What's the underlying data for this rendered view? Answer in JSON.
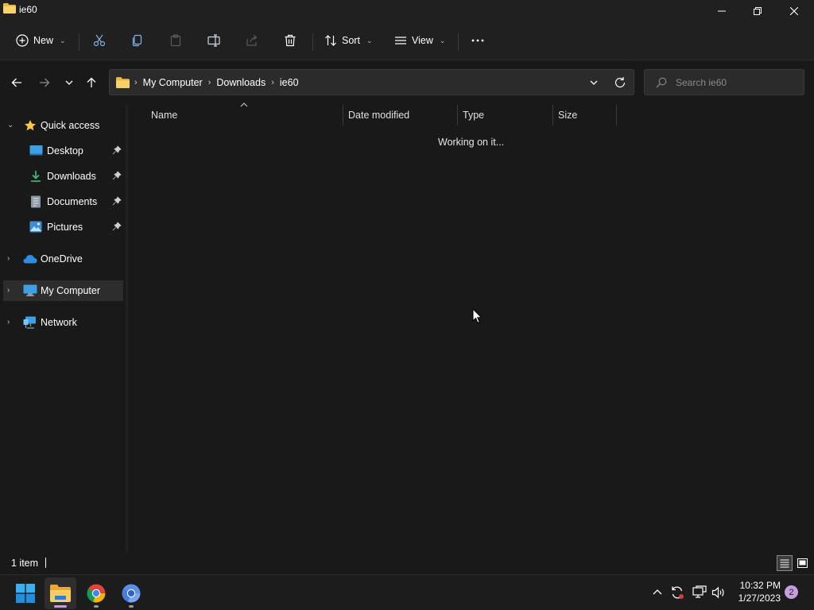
{
  "window": {
    "title": "ie60"
  },
  "toolbar": {
    "new_label": "New",
    "sort_label": "Sort",
    "view_label": "View",
    "buttons": [
      "cut-icon",
      "copy-icon",
      "paste-icon",
      "rename-icon",
      "share-icon",
      "delete-icon",
      "more-icon"
    ]
  },
  "address": {
    "crumbs": [
      "My Computer",
      "Downloads",
      "ie60"
    ],
    "search_placeholder": "Search ie60"
  },
  "navpane": {
    "quick_access": "Quick access",
    "desktop": "Desktop",
    "downloads": "Downloads",
    "documents": "Documents",
    "pictures": "Pictures",
    "onedrive": "OneDrive",
    "my_computer": "My Computer",
    "network": "Network"
  },
  "columns": {
    "name": "Name",
    "date_modified": "Date modified",
    "type": "Type",
    "size": "Size"
  },
  "content": {
    "status": "Working on it..."
  },
  "statusbar": {
    "item_count": "1 item"
  },
  "taskbar": {
    "time": "10:32 PM",
    "date": "1/27/2023",
    "notification_count": "2"
  },
  "colors": {
    "accent_folder": "#f7c94a",
    "background": "#191919",
    "selected": "#2d2d2d"
  }
}
